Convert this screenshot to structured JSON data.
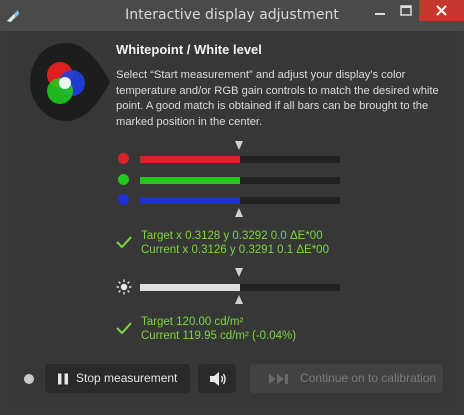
{
  "window": {
    "title": "Interactive display adjustment"
  },
  "heading": "Whitepoint / White level",
  "description": "Select “Start measurement” and adjust your display's color temperature and/or RGB gain controls to match the desired white point. A good match is obtained if all bars can be brought to the marked position in the center.",
  "rgb_bars": [
    {
      "channel": "red",
      "fill_fraction": 0.5,
      "color": "#d8232a"
    },
    {
      "channel": "green",
      "fill_fraction": 0.5,
      "color": "#22c81e"
    },
    {
      "channel": "blue",
      "fill_fraction": 0.5,
      "color": "#1e2fd8"
    }
  ],
  "whitepoint": {
    "target": "Target x 0.3128 y 0.3292 0.0 ΔE*00",
    "current": "Current x 0.3126 y 0.3291 0.1 ΔE*00"
  },
  "white_level_bar": {
    "fill_fraction": 0.5,
    "color": "#e0e0e0"
  },
  "white_level": {
    "target": "Target 120.00 cd/m²",
    "current": "Current 119.95 cd/m² (-0.04%)"
  },
  "buttons": {
    "stop": "Stop measurement",
    "continue": "Continue on to calibration"
  },
  "icons": {
    "app": "app-icon",
    "minimize": "minimize-icon",
    "maximize": "maximize-icon",
    "close": "close-icon",
    "brightness": "sun-icon",
    "pause": "pause-icon",
    "sound": "speaker-icon",
    "skip": "skip-forward-icon"
  },
  "colors": {
    "accent_green": "#7bd640",
    "close_red": "#c7372e"
  }
}
